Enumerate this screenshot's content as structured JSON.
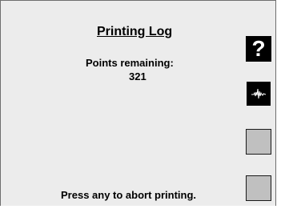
{
  "screen": {
    "title": "Printing Log",
    "remaining_label": "Points remaining:",
    "remaining_value": "321",
    "footer": "Press any to abort printing."
  },
  "side_buttons": [
    {
      "icon": "help-icon",
      "glyph": "?"
    },
    {
      "icon": "waveform-icon"
    },
    {
      "icon": "none"
    },
    {
      "icon": "none"
    }
  ],
  "colors": {
    "background": "#ececec",
    "border": "#6e6e6e",
    "button_dark": "#000000",
    "button_light": "#c0c0c0"
  }
}
